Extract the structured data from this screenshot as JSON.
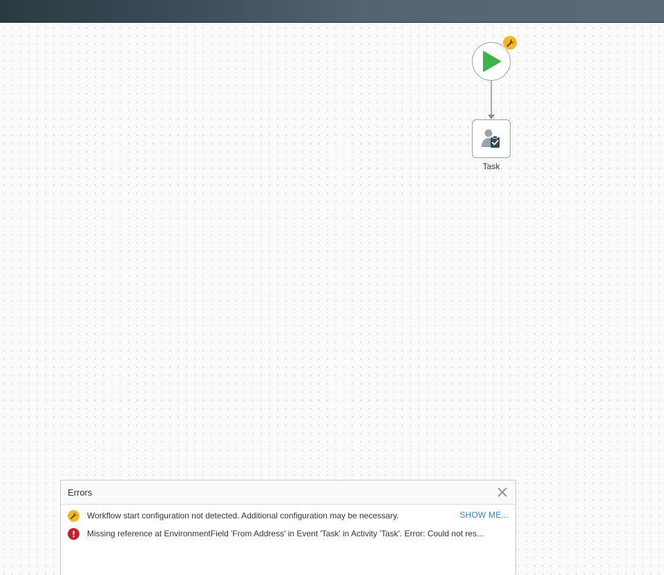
{
  "canvas": {
    "task_node": {
      "label": "Task"
    }
  },
  "errors_panel": {
    "title": "Errors",
    "items": [
      {
        "type": "warning",
        "icon": "wrench-icon",
        "message": "Workflow start configuration not detected. Additional configuration may be necessary.",
        "action": "SHOW ME..."
      },
      {
        "type": "error",
        "icon": "exclamation-icon",
        "message": "Missing reference at EnvironmentField 'From Address' in Event 'Task' in Activity 'Task'. Error: Could not res..."
      }
    ]
  },
  "colors": {
    "play_green": "#3cb44a",
    "warning_badge": "#f2b62a",
    "error_red": "#c8202b",
    "link_blue": "#2a86c8",
    "topbar_dark": "#2b3a42"
  }
}
